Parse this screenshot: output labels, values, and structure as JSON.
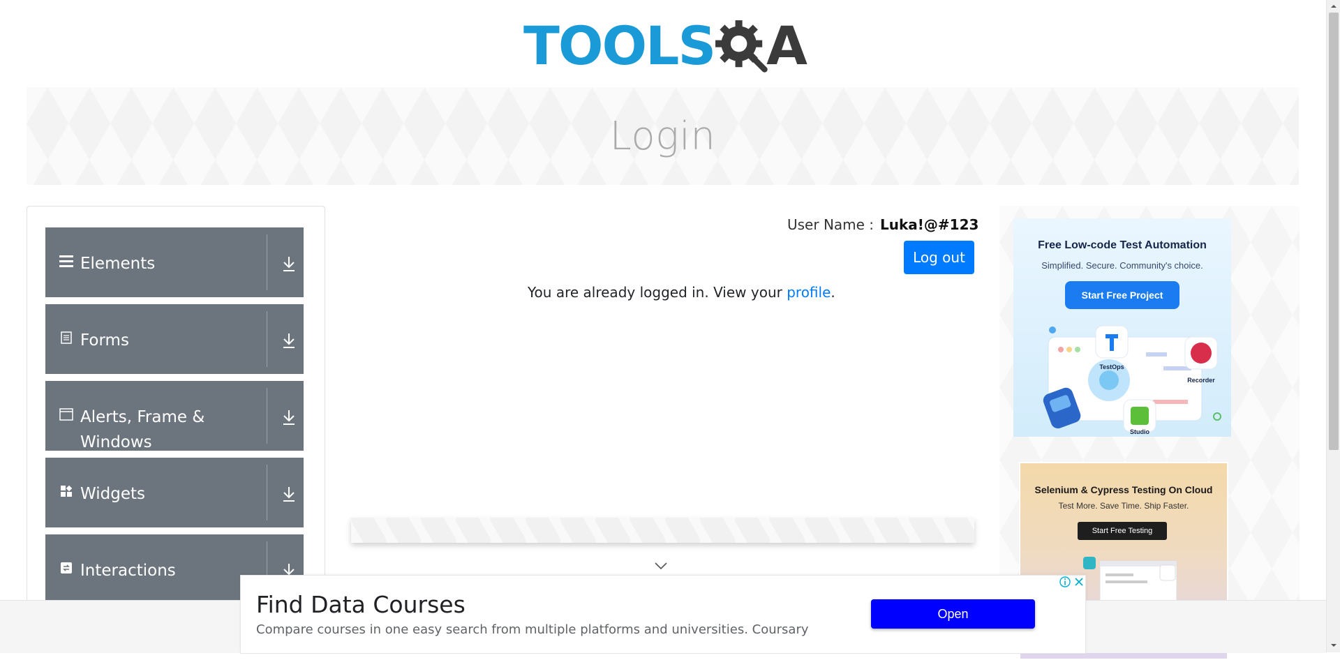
{
  "header": {
    "logo_text_left": "TOOLS",
    "logo_text_right": "A",
    "brand_colors": {
      "tools": "#1a9bd7",
      "qa": "#3b3b3b"
    }
  },
  "banner": {
    "title": "Login"
  },
  "sidebar": {
    "groups": [
      {
        "label": "Elements",
        "icon": "hamburger-icon"
      },
      {
        "label": "Forms",
        "icon": "document-icon"
      },
      {
        "label": "Alerts, Frame & Windows",
        "icon": "window-icon"
      },
      {
        "label": "Widgets",
        "icon": "widgets-icon"
      },
      {
        "label": "Interactions",
        "icon": "interactions-icon"
      }
    ],
    "colors": {
      "group_bg": "#6c757d"
    }
  },
  "profile": {
    "username_label": "User Name :",
    "username_value": "Luka!@#123",
    "logout_label": "Log out",
    "status_prefix": "You are already logged in. View your ",
    "status_link": "profile",
    "status_suffix": "."
  },
  "ads": {
    "right_top": {
      "title": "Free Low-code Test Automation",
      "subtitle": "Simplified. Secure. Community's choice.",
      "cta": "Start Free Project",
      "labels": [
        "TestOps",
        "Recorder",
        "Studio"
      ]
    },
    "right_bottom": {
      "title": "Selenium & Cypress Testing On Cloud",
      "subtitle": "Test More. Save Time. Ship Faster.",
      "cta": "Start Free Testing"
    },
    "bottom": {
      "title": "Find Data Courses",
      "description": "Compare courses in one easy search from multiple platforms and universities. Coursary",
      "open_label": "Open"
    }
  },
  "colors": {
    "primary": "#007bff",
    "ad_open": "#0000ff"
  }
}
